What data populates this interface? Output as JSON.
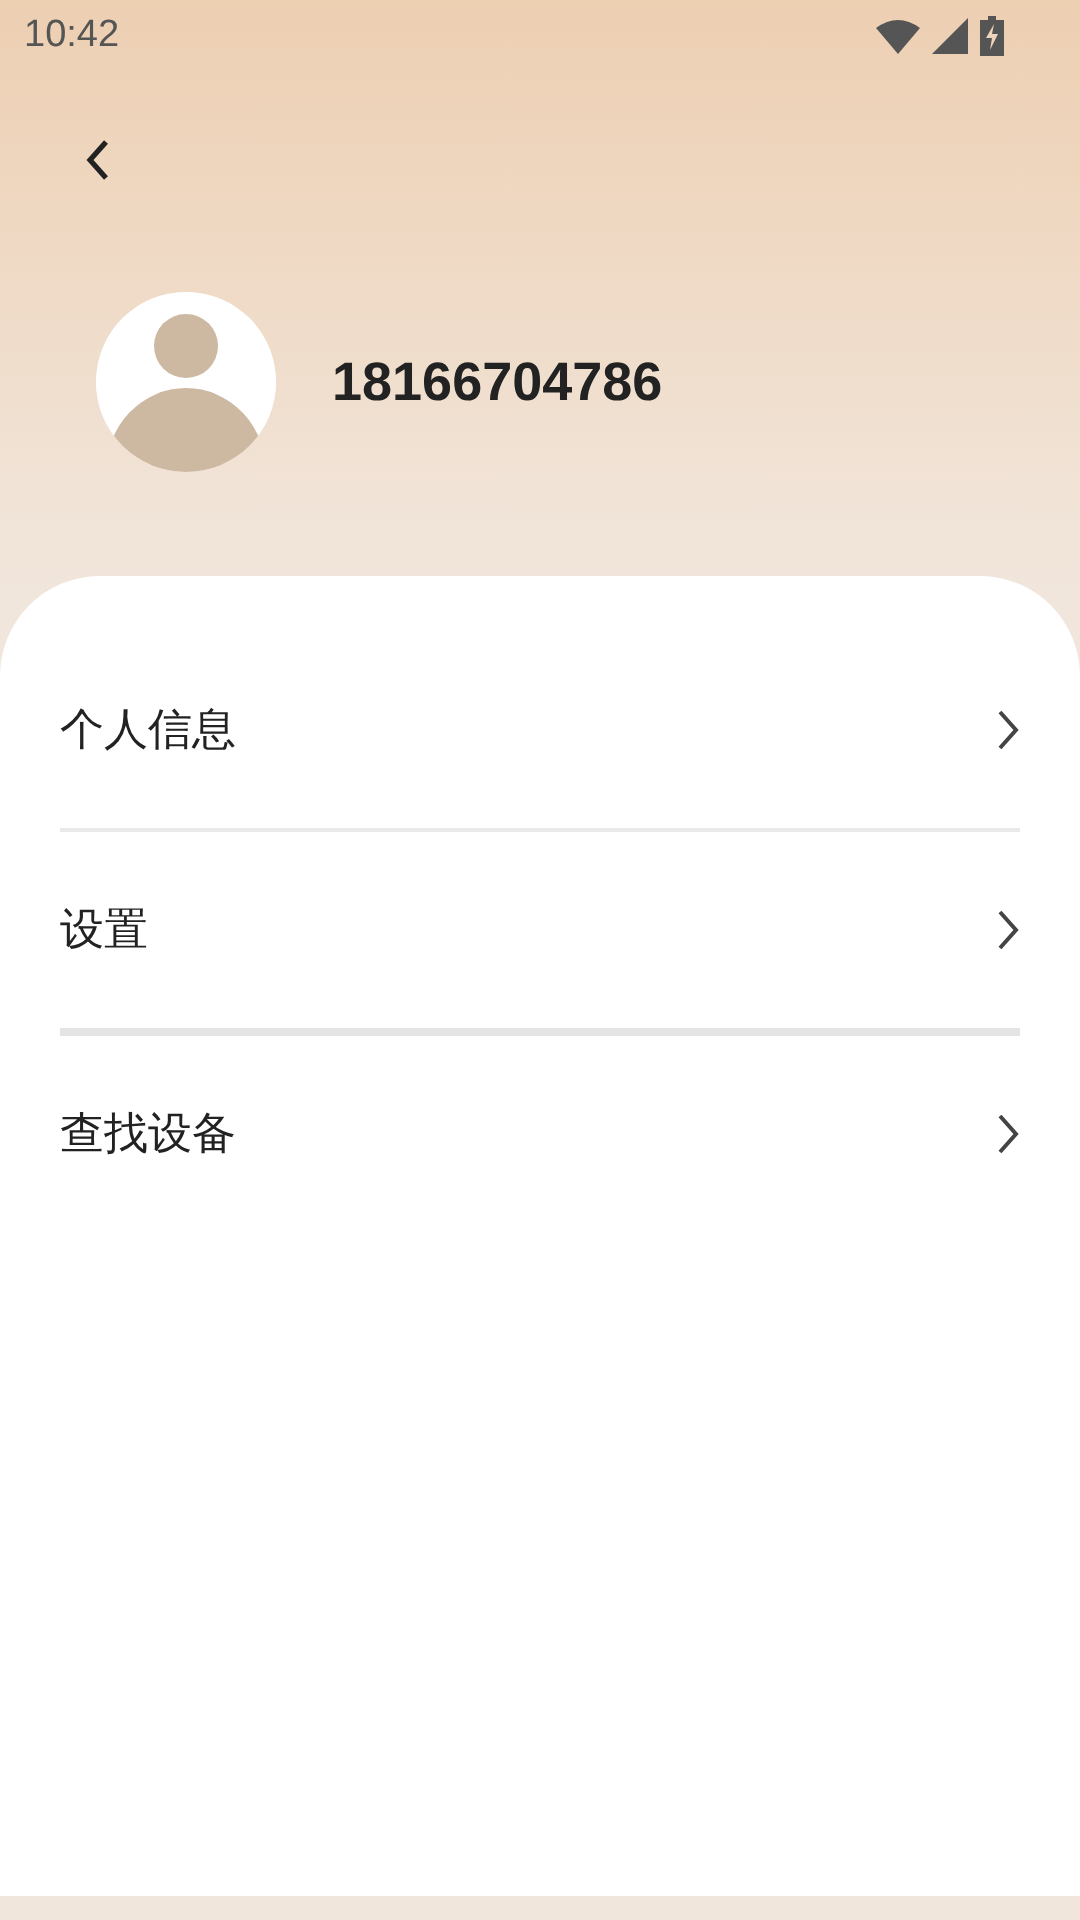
{
  "status_bar": {
    "time": "10:42"
  },
  "profile": {
    "phone": "18166704786"
  },
  "menu": [
    {
      "label": "个人信息"
    },
    {
      "label": "设置"
    },
    {
      "label": "查找设备"
    }
  ],
  "dividers": [
    {
      "thick": false
    },
    {
      "thick": true
    }
  ]
}
